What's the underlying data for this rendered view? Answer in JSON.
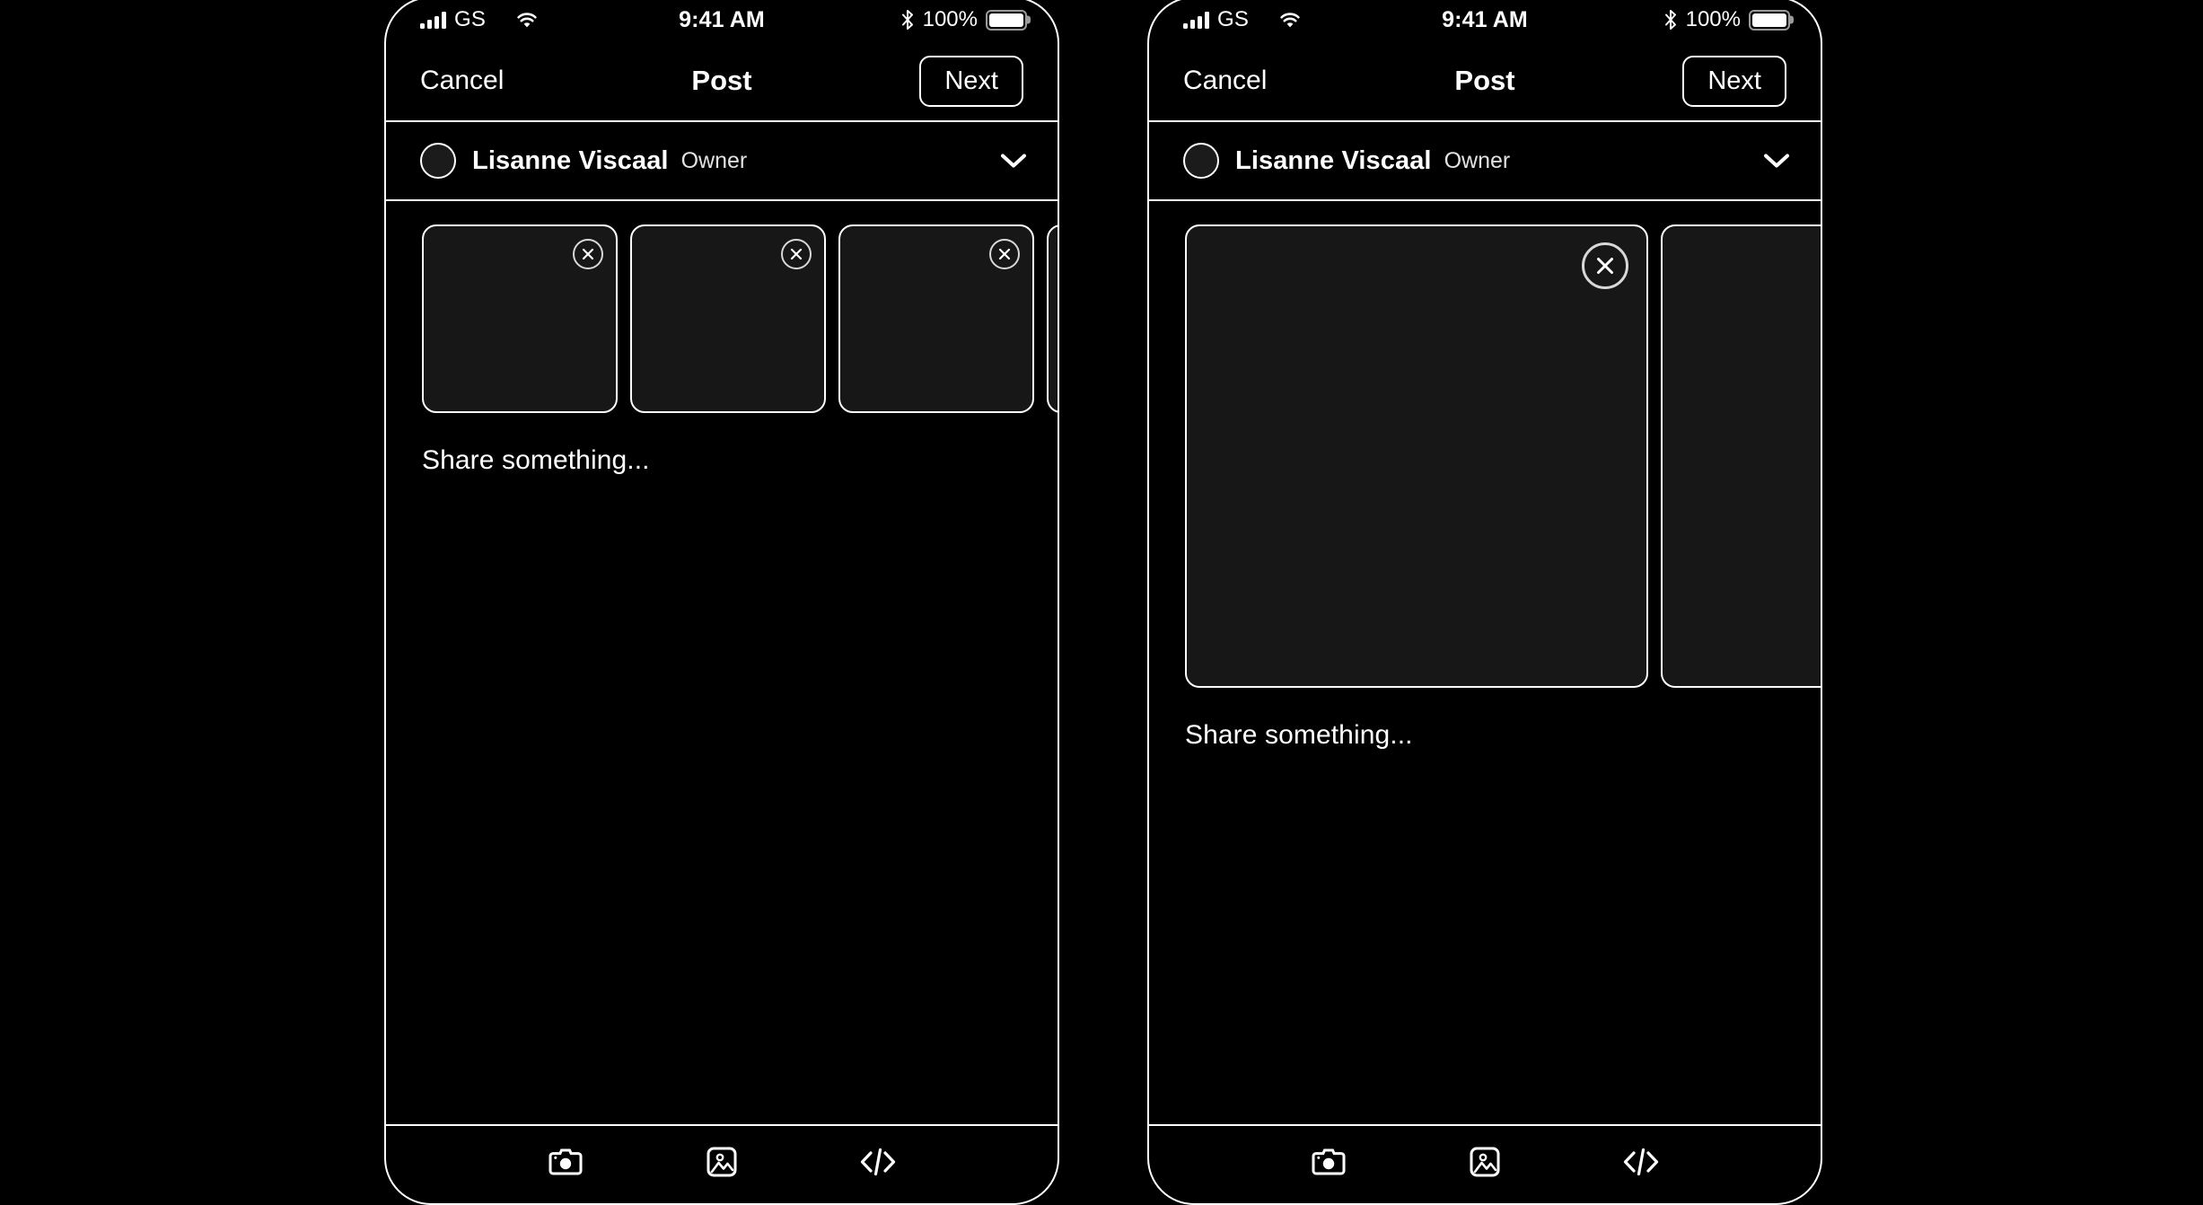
{
  "screen": {
    "background_color": "#000000",
    "foreground_color": "#ffffff",
    "thumb_fill_color": "#171717"
  },
  "status_bar": {
    "carrier": "GS",
    "signal_icon": "signal-bars-icon",
    "wifi_icon": "wifi-icon",
    "time": "9:41 AM",
    "bluetooth_icon": "bluetooth-icon",
    "battery_percent": "100%",
    "battery_icon": "battery-full-icon"
  },
  "nav_bar": {
    "cancel_label": "Cancel",
    "title": "Post",
    "next_label": "Next"
  },
  "author": {
    "avatar_icon": "avatar",
    "name": "Lisanne Viscaal",
    "role": "Owner",
    "chevron_icon": "chevron-down-icon"
  },
  "composer": {
    "placeholder": "Share something...",
    "value": ""
  },
  "toolbar": {
    "items": [
      {
        "name": "camera-icon",
        "label": "Camera"
      },
      {
        "name": "image-icon",
        "label": "Photo"
      },
      {
        "name": "code-icon",
        "label": "Code"
      }
    ]
  },
  "screens": [
    {
      "id": "multi-thumbnail-variant",
      "media_layout": "small-thumbnails",
      "media": [
        {
          "close_icon": "close-circle-icon",
          "size": "small"
        },
        {
          "close_icon": "close-circle-icon",
          "size": "small"
        },
        {
          "close_icon": "close-circle-icon",
          "size": "small"
        },
        {
          "close_icon": "close-circle-icon",
          "size": "small"
        }
      ]
    },
    {
      "id": "large-thumbnail-variant",
      "media_layout": "large-thumbnails",
      "media": [
        {
          "close_icon": "close-circle-icon",
          "size": "large"
        },
        {
          "close_icon": "close-circle-icon",
          "size": "large"
        }
      ]
    }
  ]
}
